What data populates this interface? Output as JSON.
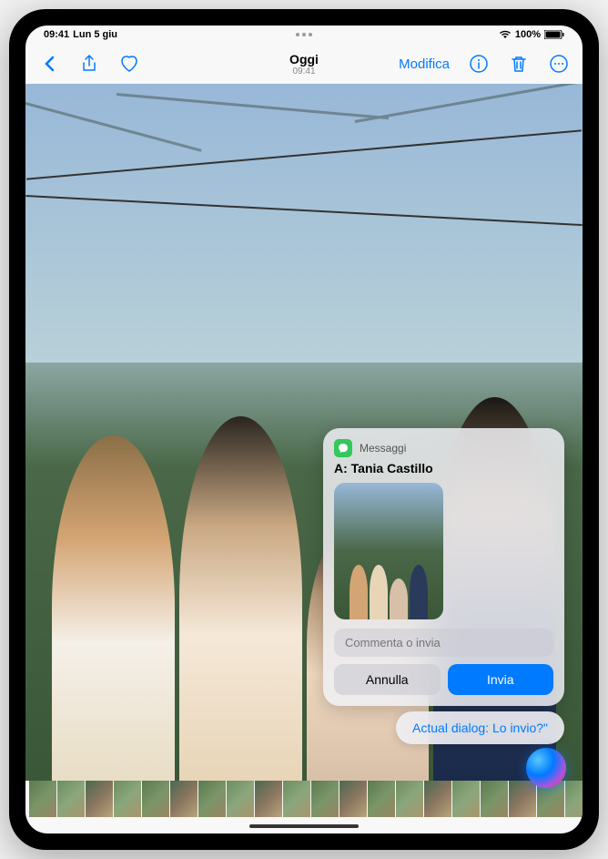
{
  "status_bar": {
    "time": "09:41",
    "date": "Lun 5 giu",
    "battery_percent": "100%"
  },
  "toolbar": {
    "title": "Oggi",
    "subtitle": "09:41",
    "edit_label": "Modifica"
  },
  "siri_popup": {
    "app_name": "Messaggi",
    "recipient_prefix": "A:",
    "recipient_name": "Tania Castillo",
    "input_placeholder": "Commenta o invia",
    "cancel_label": "Annulla",
    "send_label": "Invia"
  },
  "siri_dialog": {
    "text": "Actual dialog: Lo invio?\""
  },
  "colors": {
    "primary": "#007aff",
    "messages_green": "#34c759"
  }
}
